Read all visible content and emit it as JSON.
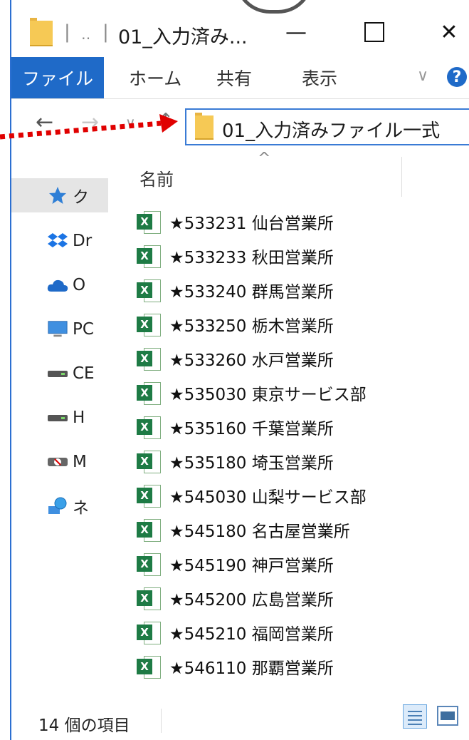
{
  "window": {
    "title": "01_入力済み...",
    "title_separator": "|",
    "quick_access_glyph": "‥",
    "minimize_glyph": "—",
    "close_glyph": "✕"
  },
  "ribbon": {
    "tabs": [
      {
        "label": "ファイル"
      },
      {
        "label": "ホーム"
      },
      {
        "label": "共有"
      },
      {
        "label": "表示"
      }
    ],
    "expand_glyph": "∨",
    "help_glyph": "?"
  },
  "navigation": {
    "back_glyph": "←",
    "forward_glyph": "→",
    "recent_glyph": "∨",
    "up_glyph": "↑",
    "address": "01_入力済みファイル一式"
  },
  "nav_pane": {
    "items": [
      {
        "label": "ク",
        "icon": "quick-access-star-icon"
      },
      {
        "label": "Dr",
        "icon": "dropbox-icon"
      },
      {
        "label": "O",
        "icon": "onedrive-icon"
      },
      {
        "label": "PC",
        "icon": "pc-icon"
      },
      {
        "label": "CE",
        "icon": "drive-icon"
      },
      {
        "label": "H",
        "icon": "drive-icon"
      },
      {
        "label": "M",
        "icon": "network-drive-icon"
      },
      {
        "label": "ネ",
        "icon": "network-icon"
      }
    ]
  },
  "file_list": {
    "sort_glyph": "^",
    "column_name": "名前",
    "files": [
      {
        "name": "★533231 仙台営業所"
      },
      {
        "name": "★533233 秋田営業所"
      },
      {
        "name": "★533240 群馬営業所"
      },
      {
        "name": "★533250 栃木営業所"
      },
      {
        "name": "★533260 水戸営業所"
      },
      {
        "name": "★535030 東京サービス部"
      },
      {
        "name": "★535160 千葉営業所"
      },
      {
        "name": "★535180 埼玉営業所"
      },
      {
        "name": "★545030 山梨サービス部"
      },
      {
        "name": "★545180 名古屋営業所"
      },
      {
        "name": "★545190 神戸営業所"
      },
      {
        "name": "★545200 広島営業所"
      },
      {
        "name": "★545210 福岡営業所"
      },
      {
        "name": "★546110 那覇営業所"
      }
    ],
    "file_icon_letter": "X"
  },
  "status_bar": {
    "item_count": "14 個の項目"
  },
  "colors": {
    "accent": "#1f6ac8",
    "annotation_arrow": "#e00000",
    "excel_green": "#1e7b45",
    "folder_yellow": "#f6c955"
  }
}
